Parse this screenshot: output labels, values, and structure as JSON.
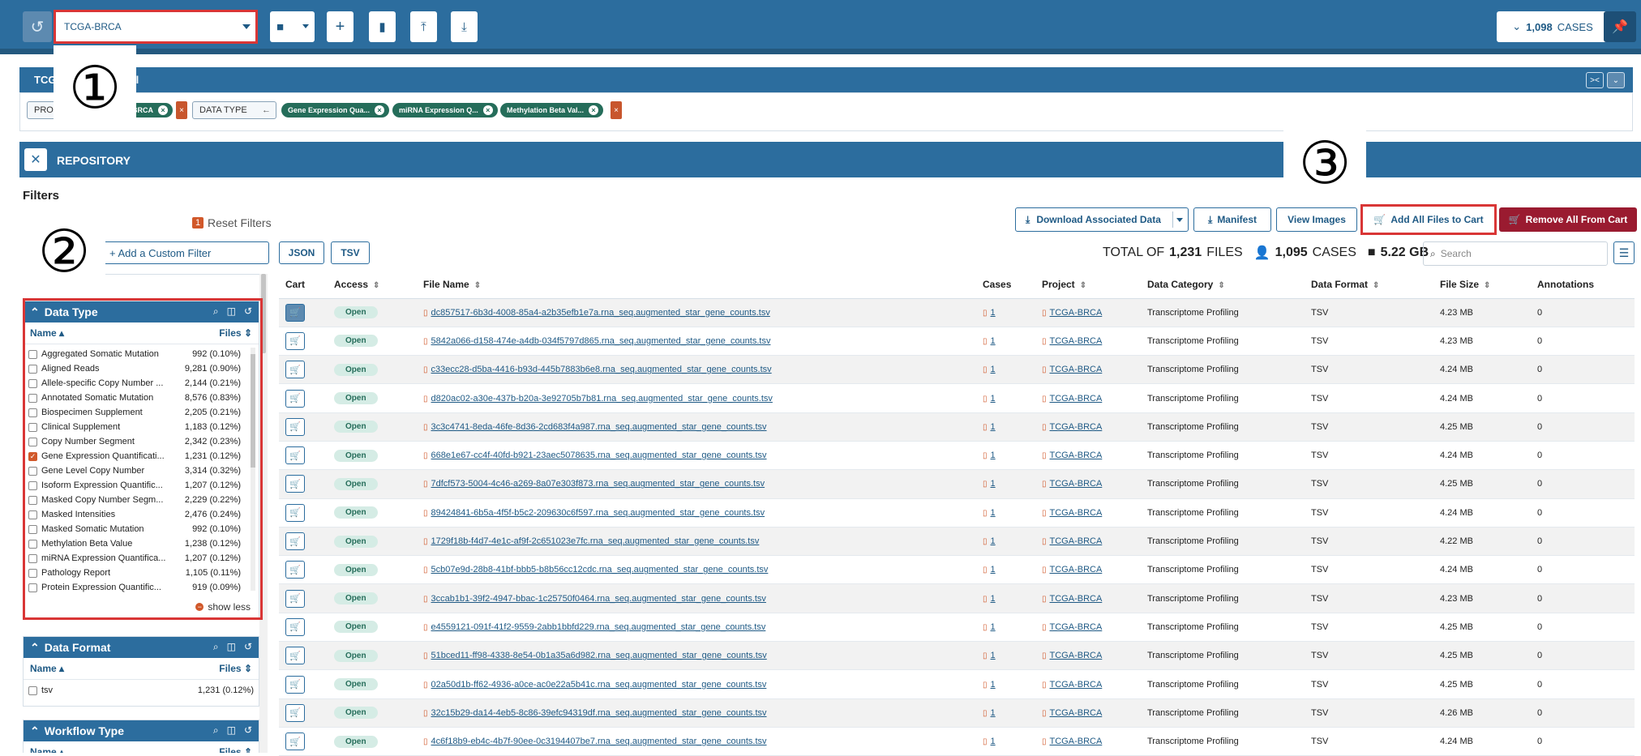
{
  "topbar": {
    "cohort_name": "TCGA-BRCA",
    "cases_count": "1,098",
    "cases_label": "CASES"
  },
  "callouts": [
    "①",
    "②",
    "③"
  ],
  "cohort_bar": {
    "title": "TCGA",
    "tail": "ll"
  },
  "query": {
    "chip1_label": "PRO",
    "chip1_value": "BRCA",
    "chip2_label": "DATA TYPE",
    "values": [
      "Gene Expression Qua...",
      "miRNA Expression Q...",
      "Methylation Beta Val..."
    ]
  },
  "repository": {
    "label": "REPOSITORY"
  },
  "filters": {
    "title": "Filters",
    "reset_count": "1",
    "reset_label": "Reset Filters",
    "add_custom": "+ Add a Custom Filter",
    "json_label": "JSON",
    "tsv_label": "TSV"
  },
  "facets": {
    "data_type": {
      "title": "Data Type",
      "col_name": "Name",
      "col_files": "Files",
      "items": [
        {
          "name": "Aggregated Somatic Mutation",
          "count": "992 (0.10%)",
          "checked": false
        },
        {
          "name": "Aligned Reads",
          "count": "9,281 (0.90%)",
          "checked": false
        },
        {
          "name": "Allele-specific Copy Number ...",
          "count": "2,144 (0.21%)",
          "checked": false
        },
        {
          "name": "Annotated Somatic Mutation",
          "count": "8,576 (0.83%)",
          "checked": false
        },
        {
          "name": "Biospecimen Supplement",
          "count": "2,205 (0.21%)",
          "checked": false
        },
        {
          "name": "Clinical Supplement",
          "count": "1,183 (0.12%)",
          "checked": false
        },
        {
          "name": "Copy Number Segment",
          "count": "2,342 (0.23%)",
          "checked": false
        },
        {
          "name": "Gene Expression Quantificati...",
          "count": "1,231 (0.12%)",
          "checked": true
        },
        {
          "name": "Gene Level Copy Number",
          "count": "3,314 (0.32%)",
          "checked": false
        },
        {
          "name": "Isoform Expression Quantific...",
          "count": "1,207 (0.12%)",
          "checked": false
        },
        {
          "name": "Masked Copy Number Segm...",
          "count": "2,229 (0.22%)",
          "checked": false
        },
        {
          "name": "Masked Intensities",
          "count": "2,476 (0.24%)",
          "checked": false
        },
        {
          "name": "Masked Somatic Mutation",
          "count": "992 (0.10%)",
          "checked": false
        },
        {
          "name": "Methylation Beta Value",
          "count": "1,238 (0.12%)",
          "checked": false
        },
        {
          "name": "miRNA Expression Quantifica...",
          "count": "1,207 (0.12%)",
          "checked": false
        },
        {
          "name": "Pathology Report",
          "count": "1,105 (0.11%)",
          "checked": false
        },
        {
          "name": "Protein Expression Quantific...",
          "count": "919 (0.09%)",
          "checked": false
        }
      ],
      "show_less": "show less"
    },
    "data_format": {
      "title": "Data Format",
      "col_name": "Name",
      "col_files": "Files",
      "items": [
        {
          "name": "tsv",
          "count": "1,231 (0.12%)",
          "checked": false
        }
      ]
    },
    "workflow_type": {
      "title": "Workflow Type",
      "col_name": "Name",
      "col_files": "Files"
    }
  },
  "actions": {
    "download_associated": "Download Associated Data",
    "manifest": "Manifest",
    "view_images": "View Images",
    "add_all": "Add All Files to Cart",
    "remove_all": "Remove All From Cart"
  },
  "totals": {
    "prefix": "TOTAL OF",
    "files_count": "1,231",
    "files_label": "FILES",
    "cases_count": "1,095",
    "cases_label": "CASES",
    "size": "5.22 GB",
    "search_placeholder": "Search"
  },
  "table": {
    "columns": [
      "Cart",
      "Access",
      "File Name",
      "Cases",
      "Project",
      "Data Category",
      "Data Format",
      "File Size",
      "Annotations"
    ],
    "rows": [
      {
        "access": "Open",
        "file": "dc857517-6b3d-4008-85a4-a2b35efb1e7a.rna_seq.augmented_star_gene_counts.tsv",
        "cases": "1",
        "project": "TCGA-BRCA",
        "category": "Transcriptome Profiling",
        "format": "TSV",
        "size": "4.23 MB",
        "ann": "0"
      },
      {
        "access": "Open",
        "file": "5842a066-d158-474e-a4db-034f5797d865.rna_seq.augmented_star_gene_counts.tsv",
        "cases": "1",
        "project": "TCGA-BRCA",
        "category": "Transcriptome Profiling",
        "format": "TSV",
        "size": "4.23 MB",
        "ann": "0"
      },
      {
        "access": "Open",
        "file": "c33ecc28-d5ba-4416-b93d-445b7883b6e8.rna_seq.augmented_star_gene_counts.tsv",
        "cases": "1",
        "project": "TCGA-BRCA",
        "category": "Transcriptome Profiling",
        "format": "TSV",
        "size": "4.24 MB",
        "ann": "0"
      },
      {
        "access": "Open",
        "file": "d820ac02-a30e-437b-b20a-3e92705b7b81.rna_seq.augmented_star_gene_counts.tsv",
        "cases": "1",
        "project": "TCGA-BRCA",
        "category": "Transcriptome Profiling",
        "format": "TSV",
        "size": "4.24 MB",
        "ann": "0"
      },
      {
        "access": "Open",
        "file": "3c3c4741-8eda-46fe-8d36-2cd683f4a987.rna_seq.augmented_star_gene_counts.tsv",
        "cases": "1",
        "project": "TCGA-BRCA",
        "category": "Transcriptome Profiling",
        "format": "TSV",
        "size": "4.25 MB",
        "ann": "0"
      },
      {
        "access": "Open",
        "file": "668e1e67-cc4f-40fd-b921-23aec5078635.rna_seq.augmented_star_gene_counts.tsv",
        "cases": "1",
        "project": "TCGA-BRCA",
        "category": "Transcriptome Profiling",
        "format": "TSV",
        "size": "4.24 MB",
        "ann": "0"
      },
      {
        "access": "Open",
        "file": "7dfcf573-5004-4c46-a269-8a07e303f873.rna_seq.augmented_star_gene_counts.tsv",
        "cases": "1",
        "project": "TCGA-BRCA",
        "category": "Transcriptome Profiling",
        "format": "TSV",
        "size": "4.25 MB",
        "ann": "0"
      },
      {
        "access": "Open",
        "file": "89424841-6b5a-4f5f-b5c2-209630c6f597.rna_seq.augmented_star_gene_counts.tsv",
        "cases": "1",
        "project": "TCGA-BRCA",
        "category": "Transcriptome Profiling",
        "format": "TSV",
        "size": "4.24 MB",
        "ann": "0"
      },
      {
        "access": "Open",
        "file": "1729f18b-f4d7-4e1c-af9f-2c651023e7fc.rna_seq.augmented_star_gene_counts.tsv",
        "cases": "1",
        "project": "TCGA-BRCA",
        "category": "Transcriptome Profiling",
        "format": "TSV",
        "size": "4.22 MB",
        "ann": "0"
      },
      {
        "access": "Open",
        "file": "5cb07e9d-28b8-41bf-bbb5-b8b56cc12cdc.rna_seq.augmented_star_gene_counts.tsv",
        "cases": "1",
        "project": "TCGA-BRCA",
        "category": "Transcriptome Profiling",
        "format": "TSV",
        "size": "4.24 MB",
        "ann": "0"
      },
      {
        "access": "Open",
        "file": "3ccab1b1-39f2-4947-bbac-1c25750f0464.rna_seq.augmented_star_gene_counts.tsv",
        "cases": "1",
        "project": "TCGA-BRCA",
        "category": "Transcriptome Profiling",
        "format": "TSV",
        "size": "4.23 MB",
        "ann": "0"
      },
      {
        "access": "Open",
        "file": "e4559121-091f-41f2-9559-2abb1bbfd229.rna_seq.augmented_star_gene_counts.tsv",
        "cases": "1",
        "project": "TCGA-BRCA",
        "category": "Transcriptome Profiling",
        "format": "TSV",
        "size": "4.25 MB",
        "ann": "0"
      },
      {
        "access": "Open",
        "file": "51bced11-ff98-4338-8e54-0b1a35a6d982.rna_seq.augmented_star_gene_counts.tsv",
        "cases": "1",
        "project": "TCGA-BRCA",
        "category": "Transcriptome Profiling",
        "format": "TSV",
        "size": "4.25 MB",
        "ann": "0"
      },
      {
        "access": "Open",
        "file": "02a50d1b-ff62-4936-a0ce-ac0e22a5b41c.rna_seq.augmented_star_gene_counts.tsv",
        "cases": "1",
        "project": "TCGA-BRCA",
        "category": "Transcriptome Profiling",
        "format": "TSV",
        "size": "4.25 MB",
        "ann": "0"
      },
      {
        "access": "Open",
        "file": "32c15b29-da14-4eb5-8c86-39efc94319df.rna_seq.augmented_star_gene_counts.tsv",
        "cases": "1",
        "project": "TCGA-BRCA",
        "category": "Transcriptome Profiling",
        "format": "TSV",
        "size": "4.26 MB",
        "ann": "0"
      },
      {
        "access": "Open",
        "file": "4c6f18b9-eb4c-4b7f-90ee-0c3194407be7.rna_seq.augmented_star_gene_counts.tsv",
        "cases": "1",
        "project": "TCGA-BRCA",
        "category": "Transcriptome Profiling",
        "format": "TSV",
        "size": "4.24 MB",
        "ann": "0"
      }
    ]
  }
}
